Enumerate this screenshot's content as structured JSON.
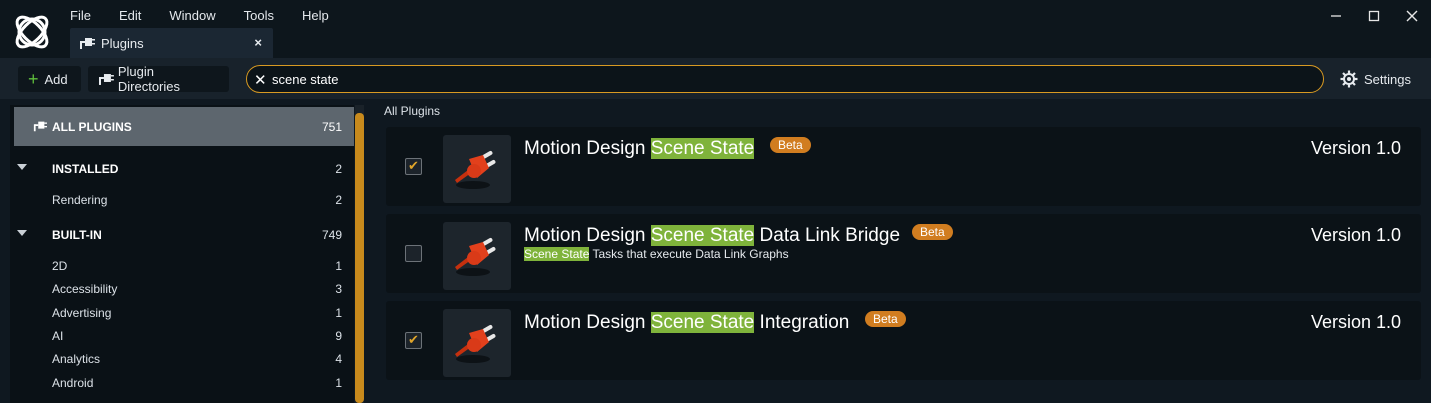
{
  "menu": [
    "File",
    "Edit",
    "Window",
    "Tools",
    "Help"
  ],
  "tab": {
    "label": "Plugins",
    "close": "×"
  },
  "toolbar": {
    "add_label": "Add",
    "dirs_label": "Plugin Directories",
    "search_value": "scene state",
    "settings_label": "Settings"
  },
  "sidebar": {
    "all": {
      "label": "ALL PLUGINS",
      "count": "751"
    },
    "items": [
      {
        "label": "INSTALLED",
        "count": "2",
        "section": true
      },
      {
        "label": "Rendering",
        "count": "2"
      },
      {
        "label": "BUILT-IN",
        "count": "749",
        "section": true
      },
      {
        "label": "2D",
        "count": "1"
      },
      {
        "label": "Accessibility",
        "count": "3"
      },
      {
        "label": "Advertising",
        "count": "1"
      },
      {
        "label": "AI",
        "count": "9"
      },
      {
        "label": "Analytics",
        "count": "4"
      },
      {
        "label": "Android",
        "count": "1"
      }
    ]
  },
  "main": {
    "heading": "All Plugins",
    "plugins": [
      {
        "pre": "Motion Design ",
        "hl": "Scene State",
        "post": "",
        "desc_hl": "",
        "desc": "",
        "beta": "Beta",
        "version": "Version 1.0",
        "checked": true
      },
      {
        "pre": "Motion Design ",
        "hl": "Scene State",
        "post": " Data Link Bridge",
        "desc_hl": "Scene State",
        "desc": " Tasks that execute Data Link Graphs",
        "beta": "Beta",
        "version": "Version 1.0",
        "checked": false
      },
      {
        "pre": "Motion Design ",
        "hl": "Scene State",
        "post": " Integration",
        "desc_hl": "",
        "desc": "",
        "beta": "Beta",
        "version": "Version 1.0",
        "checked": true
      }
    ]
  },
  "colors": {
    "accent": "#d89a22",
    "highlight": "#7fb33b",
    "beta": "#d17d20"
  }
}
